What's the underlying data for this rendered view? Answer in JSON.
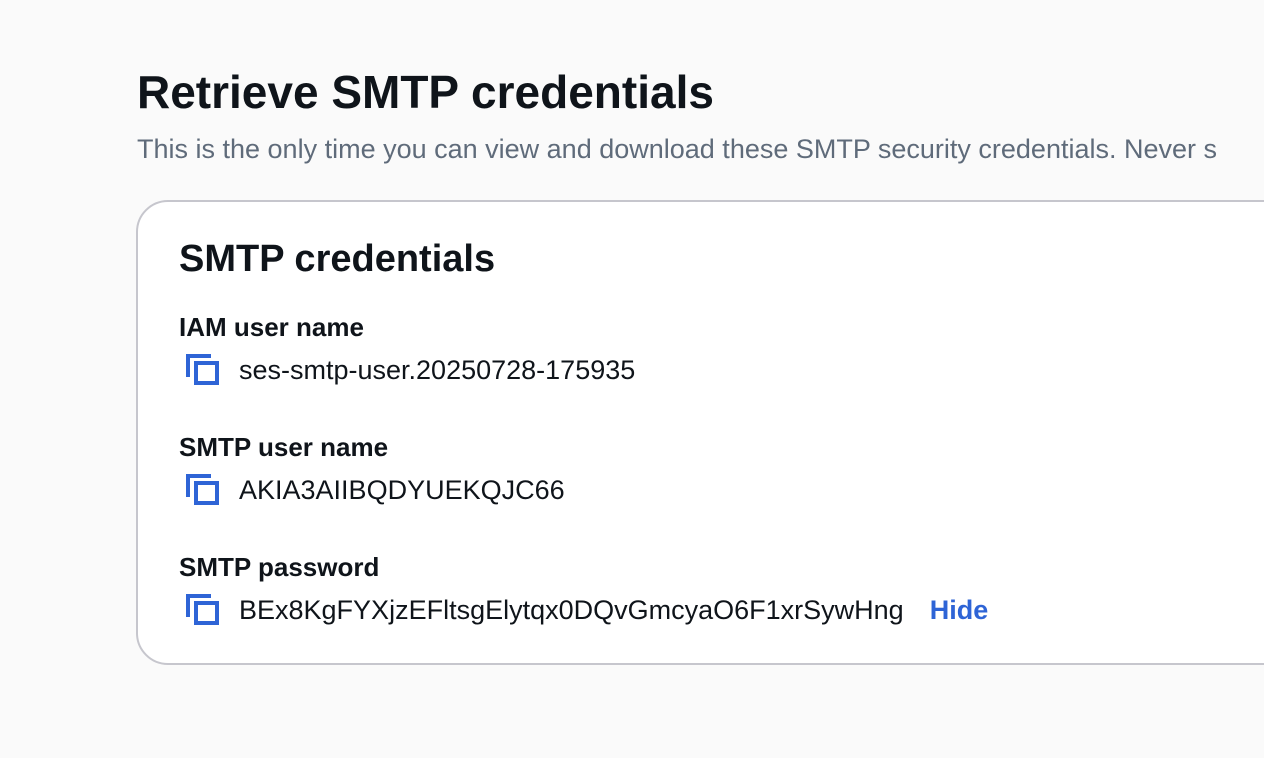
{
  "page": {
    "title": "Retrieve SMTP credentials",
    "description": "This is the only time you can view and download these SMTP security credentials. Never s"
  },
  "card": {
    "title": "SMTP credentials",
    "fields": [
      {
        "label": "IAM user name",
        "value": "ses-smtp-user.20250728-175935",
        "icon": "copy-icon"
      },
      {
        "label": "SMTP user name",
        "value": "AKIA3AIIBQDYUEKQJC66",
        "icon": "copy-icon"
      },
      {
        "label": "SMTP password",
        "value": "BEx8KgFYXjzEFltsgElytqx0DQvGmcyaO6F1xrSywHng",
        "icon": "copy-icon",
        "toggle_label": "Hide"
      }
    ]
  },
  "colors": {
    "accent": "#2e64d6",
    "text": "#0f141a",
    "muted": "#5f6b7a",
    "border": "#c6c6cd",
    "background": "#fafafa"
  }
}
